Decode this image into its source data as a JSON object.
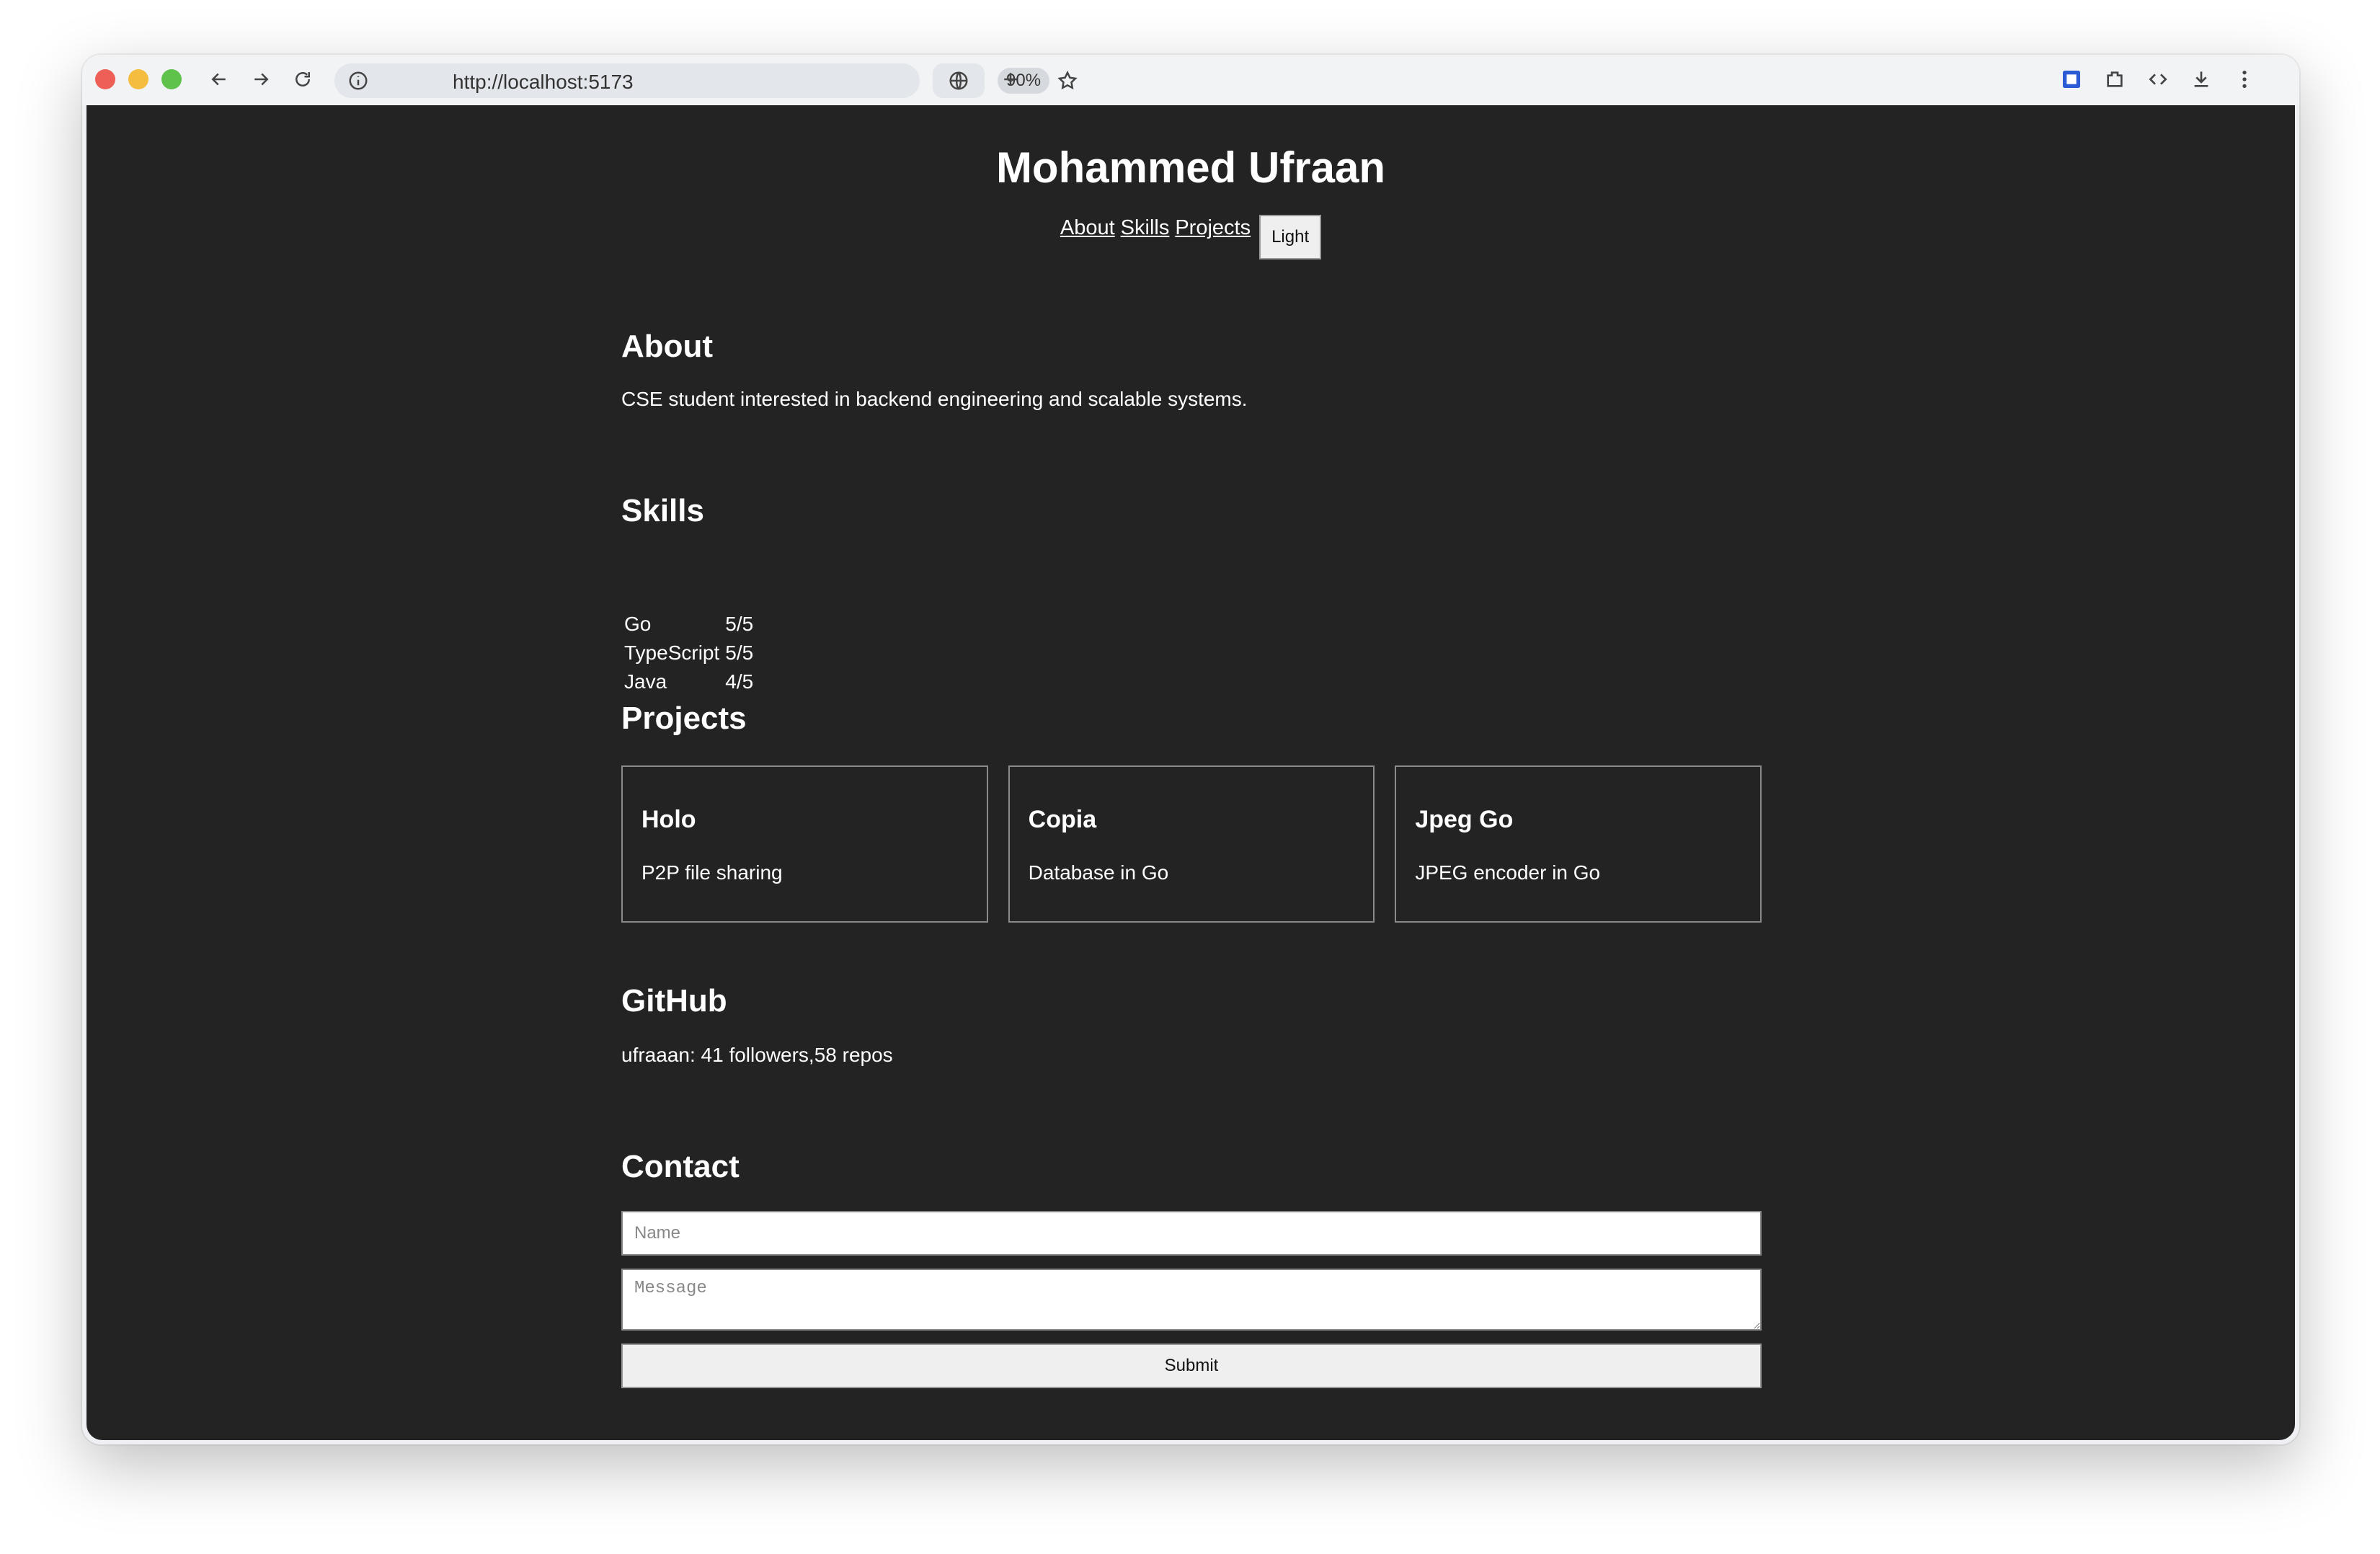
{
  "browser": {
    "url": "http://localhost:5173",
    "zoom": "90%"
  },
  "header": {
    "title": "Mohammed Ufraan",
    "nav": [
      "About",
      "Skills",
      "Projects"
    ],
    "theme_button": "Light"
  },
  "about": {
    "heading": "About",
    "text": "CSE student interested in backend engineering and scalable systems."
  },
  "skills": {
    "heading": "Skills",
    "rows": [
      {
        "name": "Go",
        "level": "5/5"
      },
      {
        "name": "TypeScript",
        "level": "5/5"
      },
      {
        "name": "Java",
        "level": "4/5"
      }
    ]
  },
  "projects": {
    "heading": "Projects",
    "items": [
      {
        "title": "Holo",
        "desc": "P2P file sharing"
      },
      {
        "title": "Copia",
        "desc": "Database in Go"
      },
      {
        "title": "Jpeg Go",
        "desc": "JPEG encoder in Go"
      }
    ]
  },
  "github": {
    "heading": "GitHub",
    "text": "ufraaan: 41 followers,58 repos"
  },
  "contact": {
    "heading": "Contact",
    "name_placeholder": "Name",
    "message_placeholder": "Message",
    "submit_label": "Submit"
  },
  "colors": {
    "page_background": "#232323",
    "text": "#ffffff"
  }
}
